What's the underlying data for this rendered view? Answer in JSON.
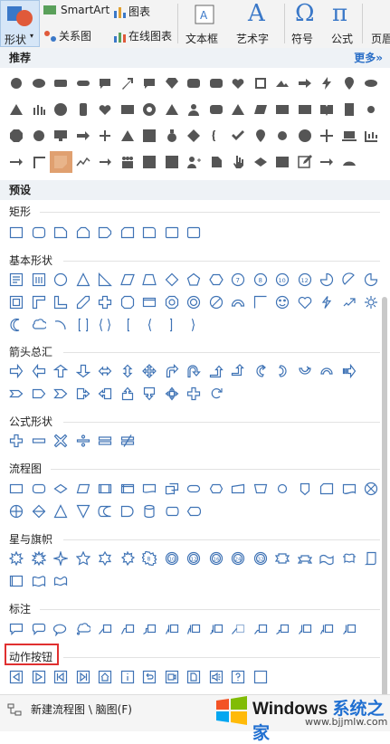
{
  "ribbon": {
    "shapes_label": "形状",
    "smartart_label": "SmartArt",
    "chart_label": "图表",
    "relation_label": "关系图",
    "online_chart_label": "在线图表",
    "textbox_label": "文本框",
    "wordart_label": "艺术字",
    "symbol_label": "符号",
    "formula_label": "公式",
    "header_label": "页眉"
  },
  "panel": {
    "recommended_title": "推荐",
    "more_label": "更多»",
    "presets_title": "预设",
    "categories": {
      "rect": "矩形",
      "basic": "基本形状",
      "arrows": "箭头总汇",
      "formula": "公式形状",
      "flow": "流程图",
      "stars": "星与旗帜",
      "callouts": "标注",
      "action": "动作按钮"
    },
    "bottom_label": "新建流程图 \\ 脑图(F)"
  },
  "watermark": {
    "title_en": "Windows",
    "title_cn": "系统之家",
    "url": "www.bjjmlw.com"
  },
  "colors": {
    "accent": "#3f73b5",
    "highlight": "#e03030",
    "link": "#2b6fc7"
  }
}
